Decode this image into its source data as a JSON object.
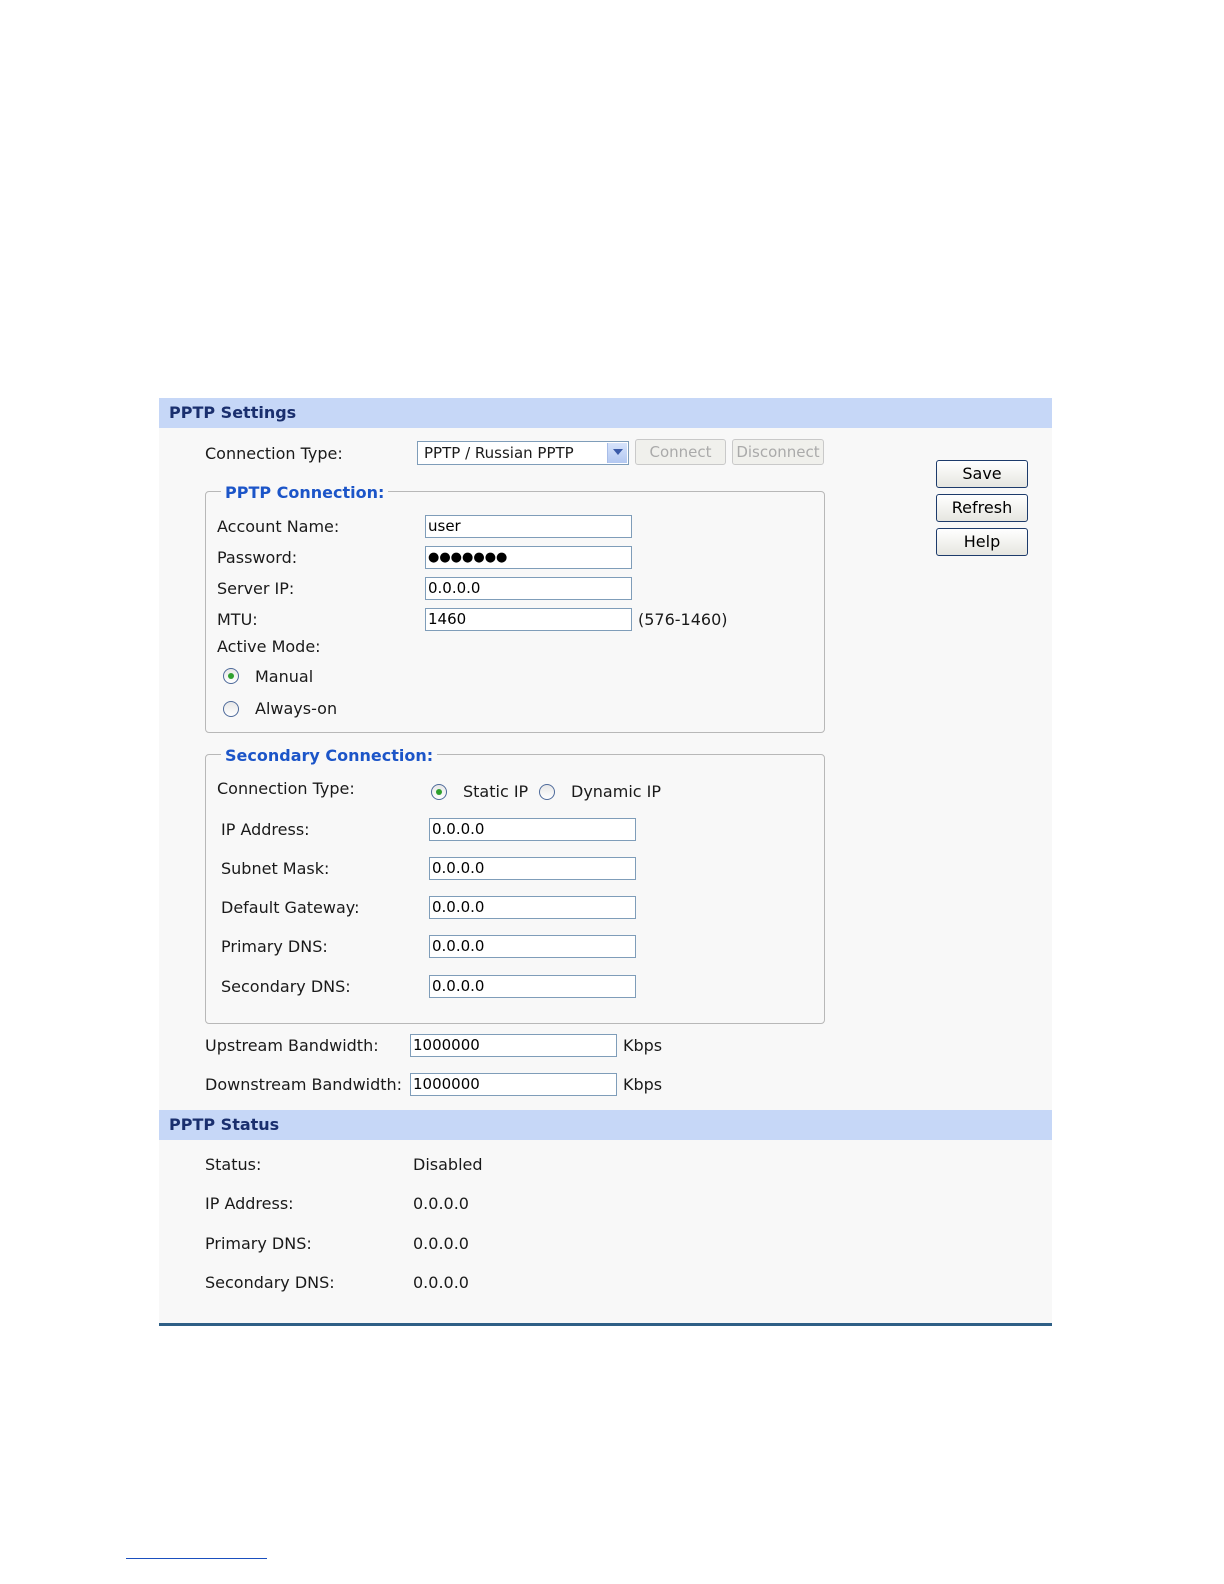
{
  "settings": {
    "header": "PPTP Settings",
    "connection_type_label": "Connection Type:",
    "connection_type_value": "PPTP / Russian PPTP",
    "connect_label": "Connect",
    "disconnect_label": "Disconnect",
    "pptp_connection": {
      "legend": "PPTP Connection:",
      "account_name_label": "Account Name:",
      "account_name_value": "user",
      "password_label": "Password:",
      "password_value": "●●●●●●●",
      "server_ip_label": "Server IP:",
      "server_ip_value": "0.0.0.0",
      "mtu_label": "MTU:",
      "mtu_value": "1460",
      "mtu_range": "(576-1460)",
      "active_mode_label": "Active Mode:",
      "manual_label": "Manual",
      "always_on_label": "Always-on",
      "active_mode_selected": "Manual"
    },
    "secondary_connection": {
      "legend": "Secondary Connection:",
      "connection_type_label": "Connection Type:",
      "static_ip_label": "Static IP",
      "dynamic_ip_label": "Dynamic IP",
      "selected": "Static IP",
      "ip_address_label": "IP Address:",
      "ip_address_value": "0.0.0.0",
      "subnet_mask_label": "Subnet Mask:",
      "subnet_mask_value": "0.0.0.0",
      "default_gateway_label": "Default Gateway:",
      "default_gateway_value": "0.0.0.0",
      "primary_dns_label": "Primary DNS:",
      "primary_dns_value": "0.0.0.0",
      "secondary_dns_label": "Secondary DNS:",
      "secondary_dns_value": "0.0.0.0"
    },
    "upstream_label": "Upstream Bandwidth:",
    "upstream_value": "1000000",
    "downstream_label": "Downstream Bandwidth:",
    "downstream_value": "1000000",
    "unit": "Kbps"
  },
  "actions": {
    "save": "Save",
    "refresh": "Refresh",
    "help": "Help"
  },
  "status": {
    "header": "PPTP Status",
    "status_label": "Status:",
    "status_value": "Disabled",
    "ip_address_label": "IP Address:",
    "ip_address_value": "0.0.0.0",
    "primary_dns_label": "Primary DNS:",
    "primary_dns_value": "0.0.0.0",
    "secondary_dns_label": "Secondary DNS:",
    "secondary_dns_value": "0.0.0.0"
  },
  "colors": {
    "header_bg": "#c6d7f7",
    "header_text": "#1a2f6e",
    "legend_text": "#1c55c8",
    "radio_dot": "#2fa02f"
  }
}
